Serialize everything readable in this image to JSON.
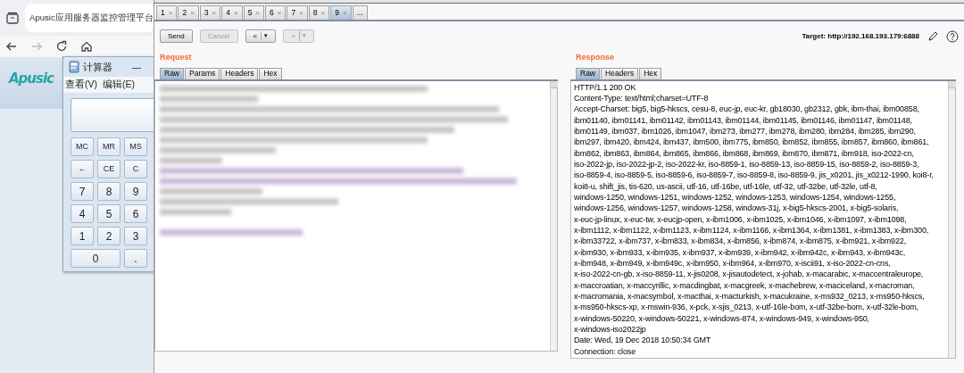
{
  "browser": {
    "tab_title": "Apusic应用服务器监控管理平台",
    "logo": "Apusic",
    "forward_disabled": true
  },
  "calculator": {
    "title": "计算器",
    "minimize": "—",
    "menu": [
      "查看(V)",
      "编辑(E)"
    ],
    "buttons": [
      {
        "label": "MC",
        "kind": "small"
      },
      {
        "label": "MR",
        "kind": "small"
      },
      {
        "label": "MS",
        "kind": "small"
      },
      {
        "label": "←",
        "kind": "small"
      },
      {
        "label": "CE",
        "kind": "small"
      },
      {
        "label": "C",
        "kind": "small"
      },
      {
        "label": "7",
        "kind": "digit"
      },
      {
        "label": "8",
        "kind": "digit"
      },
      {
        "label": "9",
        "kind": "digit"
      },
      {
        "label": "4",
        "kind": "digit"
      },
      {
        "label": "5",
        "kind": "digit"
      },
      {
        "label": "6",
        "kind": "digit"
      },
      {
        "label": "1",
        "kind": "digit"
      },
      {
        "label": "2",
        "kind": "digit"
      },
      {
        "label": "3",
        "kind": "digit"
      },
      {
        "label": "0",
        "kind": "wide"
      },
      {
        "label": ".",
        "kind": "digit"
      }
    ]
  },
  "repeater": {
    "tabs": [
      {
        "label": "1",
        "close": "×",
        "selected": false
      },
      {
        "label": "2",
        "close": "×",
        "selected": false
      },
      {
        "label": "3",
        "close": "×",
        "selected": false
      },
      {
        "label": "4",
        "close": "×",
        "selected": false
      },
      {
        "label": "5",
        "close": "×",
        "selected": false
      },
      {
        "label": "6",
        "close": "×",
        "selected": false
      },
      {
        "label": "7",
        "close": "×",
        "selected": false
      },
      {
        "label": "8",
        "close": "×",
        "selected": false
      },
      {
        "label": "9",
        "close": "×",
        "selected": true
      },
      {
        "label": "...",
        "selected": false
      }
    ],
    "buttons": [
      {
        "label": "Send",
        "kind": "plain",
        "disabled": false
      },
      {
        "label": "Cancel",
        "kind": "plain",
        "disabled": true
      },
      {
        "label": "<",
        "caret": "▾",
        "kind": "split",
        "disabled": false
      },
      {
        "label": ">",
        "caret": "▾",
        "kind": "split",
        "disabled": true
      }
    ],
    "target": "Target: http://192.168.193.179:6888",
    "request": {
      "title": "Request",
      "tabs": [
        {
          "label": "Raw",
          "selected": true
        },
        {
          "label": "Params",
          "selected": false
        },
        {
          "label": "Headers",
          "selected": false
        },
        {
          "label": "Hex",
          "selected": false
        }
      ]
    },
    "response": {
      "title": "Response",
      "tabs": [
        {
          "label": "Raw",
          "selected": true
        },
        {
          "label": "Headers",
          "selected": false
        },
        {
          "label": "Hex",
          "selected": false
        }
      ],
      "lines": [
        "HTTP/1.1 200 OK",
        "Content-Type: text/html;charset=UTF-8",
        "Accept-Charset: big5, big5-hkscs, cesu-8, euc-jp, euc-kr, gb18030, gb2312, gbk, ibm-thai, ibm00858,",
        "ibm01140, ibm01141, ibm01142, ibm01143, ibm01144, ibm01145, ibm01146, ibm01147, ibm01148,",
        "ibm01149, ibm037, ibm1026, ibm1047, ibm273, ibm277, ibm278, ibm280, ibm284, ibm285, ibm290,",
        "ibm297, ibm420, ibm424, ibm437, ibm500, ibm775, ibm850, ibm852, ibm855, ibm857, ibm860, ibm861,",
        "ibm862, ibm863, ibm864, ibm865, ibm866, ibm868, ibm869, ibm870, ibm871, ibm918, iso-2022-cn,",
        "iso-2022-jp, iso-2022-jp-2, iso-2022-kr, iso-8859-1, iso-8859-13, iso-8859-15, iso-8859-2, iso-8859-3,",
        "iso-8859-4, iso-8859-5, iso-8859-6, iso-8859-7, iso-8859-8, iso-8859-9, jis_x0201, jis_x0212-1990, koi8-r,",
        "koi8-u, shift_jis, tis-620, us-ascii, utf-16, utf-16be, utf-16le, utf-32, utf-32be, utf-32le, utf-8,",
        "windows-1250, windows-1251, windows-1252, windows-1253, windows-1254, windows-1255,",
        "windows-1256, windows-1257, windows-1258, windows-31j, x-big5-hkscs-2001, x-big5-solaris,",
        "x-euc-jp-linux, x-euc-tw, x-eucjp-open, x-ibm1006, x-ibm1025, x-ibm1046, x-ibm1097, x-ibm1098,",
        "x-ibm1112, x-ibm1122, x-ibm1123, x-ibm1124, x-ibm1166, x-ibm1364, x-ibm1381, x-ibm1383, x-ibm300,",
        "x-ibm33722, x-ibm737, x-ibm833, x-ibm834, x-ibm856, x-ibm874, x-ibm875, x-ibm921, x-ibm922,",
        "x-ibm930, x-ibm933, x-ibm935, x-ibm937, x-ibm939, x-ibm942, x-ibm942c, x-ibm943, x-ibm943c,",
        "x-ibm948, x-ibm949, x-ibm949c, x-ibm950, x-ibm964, x-ibm970, x-iscii91, x-iso-2022-cn-cns,",
        "x-iso-2022-cn-gb, x-iso-8859-11, x-jis0208, x-jisautodetect, x-johab, x-macarabic, x-maccentraleurope,",
        "x-maccroatian, x-maccyrillic, x-macdingbat, x-macgreek, x-machebrew, x-maciceland, x-macroman,",
        "x-macromania, x-macsymbol, x-macthai, x-macturkish, x-macukraine, x-ms932_0213, x-ms950-hkscs,",
        "x-ms950-hkscs-xp, x-mswin-936, x-pck, x-sjis_0213, x-utf-16le-bom, x-utf-32be-bom, x-utf-32le-bom,",
        "x-windows-50220, x-windows-50221, x-windows-874, x-windows-949, x-windows-950,",
        "x-windows-iso2022jp",
        "Date: Wed, 19 Dec 2018 10:50:34 GMT",
        "Connection: close"
      ]
    }
  }
}
